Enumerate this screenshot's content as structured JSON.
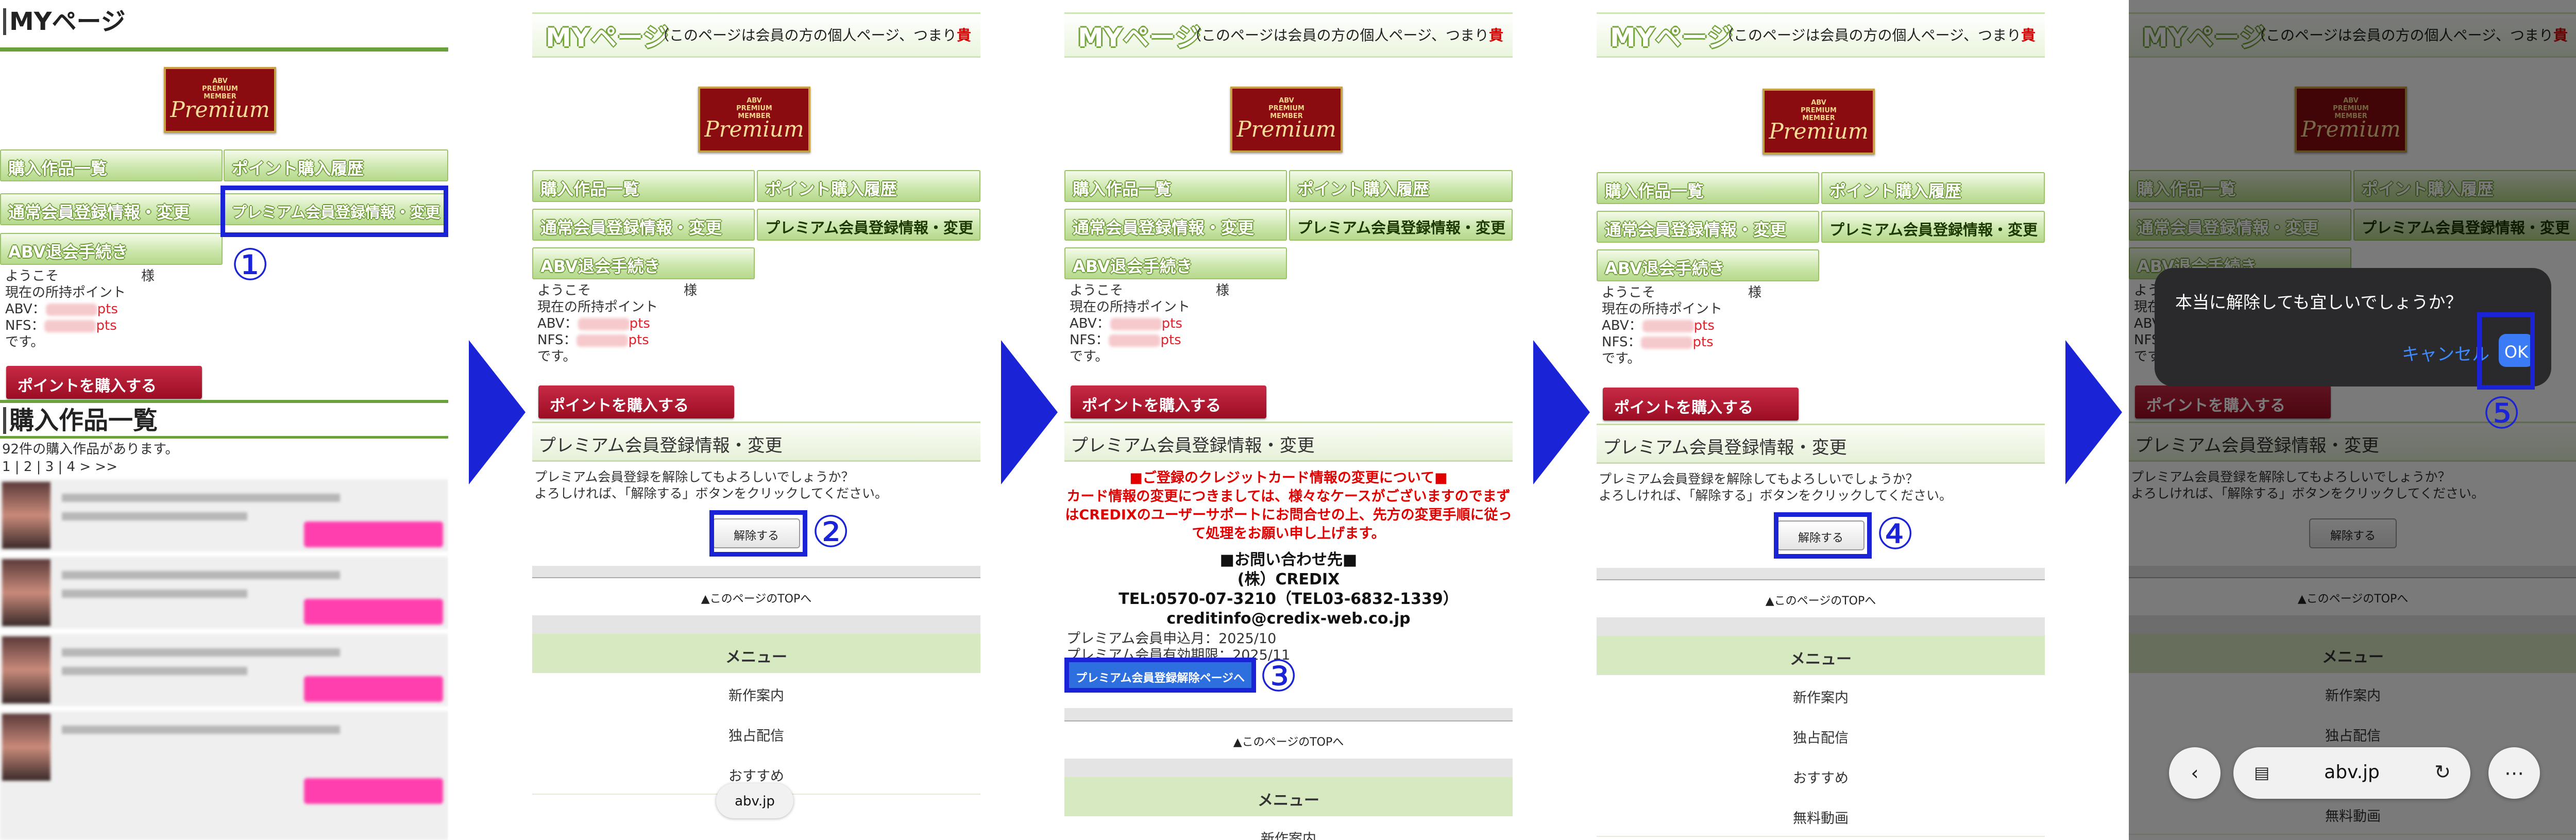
{
  "header": {
    "title": "MYページ",
    "note_prefix": "（このページは会員の方の個人ページ、つまり",
    "note_red": "貴"
  },
  "logo": {
    "small_line1": "ABV",
    "small_line2": "PREMIUM",
    "small_line3": "MEMBER",
    "script": "Premium"
  },
  "nav": {
    "purchased": "購入作品一覧",
    "points_history": "ポイント購入履歴",
    "regular_member": "通常会員登録情報・変更",
    "premium_member": "プレミアム会員登録情報・変更",
    "withdraw": "ABV退会手続き"
  },
  "account": {
    "welcome": "ようこそ",
    "sama": "様",
    "current_points": "現在の所持ポイント",
    "abv_label": "ABV：",
    "nfs_label": "NFS：",
    "pts_unit": "pts",
    "desu": "です。"
  },
  "buy_points_button": "ポイントを購入する",
  "purchased_section": {
    "title": "購入作品一覧",
    "count_text": "92件の購入作品があります。",
    "pager": [
      "1",
      "2",
      "3",
      "4",
      ">",
      ">>"
    ]
  },
  "premium_section": {
    "heading": "プレミアム会員登録情報・変更",
    "line1": "プレミアム会員登録を解除してもよろしいでしょうか？",
    "line2": "よろしければ、「解除する」ボタンをクリックしてください。",
    "cancel_button": "解除する"
  },
  "credix_notice": {
    "line1": "■ご登録のクレジットカード情報の変更について■",
    "line2": "カード情報の変更につきましては、様々なケースがございますのでまず",
    "line3": "はCREDIXのユーザーサポートにお問合せの上、先方の変更手順に従っ",
    "line4": "て処理をお願い申し上げます。",
    "contact_title": "■お問い合わせ先■",
    "company": "(株）CREDIX",
    "tel": "TEL:0570-07-3210（TEL03-6832-1339）",
    "email": "creditinfo@credix-web.co.jp",
    "apply_month": "プレミアム会員申込月：2025/10",
    "expiry_month": "プレミアム会員有効期限：2025/11",
    "cancel_page_button": "プレミアム会員登録解除ページへ"
  },
  "footer": {
    "to_top": "▲このページのTOPへ",
    "menu_heading": "メニュー",
    "menu_items": [
      "新作案内",
      "独占配信",
      "おすすめ",
      "無料動画"
    ]
  },
  "dialog": {
    "message": "本当に解除しても宜しいでしょうか？",
    "cancel": "キャンセル",
    "ok": "OK"
  },
  "browser": {
    "url": "abv.jp",
    "back_icon": "chevron-left-icon",
    "more_icon": "ellipsis-icon"
  },
  "steps": [
    "①",
    "②",
    "③",
    "④",
    "⑤"
  ],
  "colors": {
    "highlight": "#1b23d6",
    "nav_green": "#b6d98c",
    "buy_button": "#9b0d22",
    "points_red": "#e00000",
    "dialog_ok": "#3b7bf6"
  }
}
